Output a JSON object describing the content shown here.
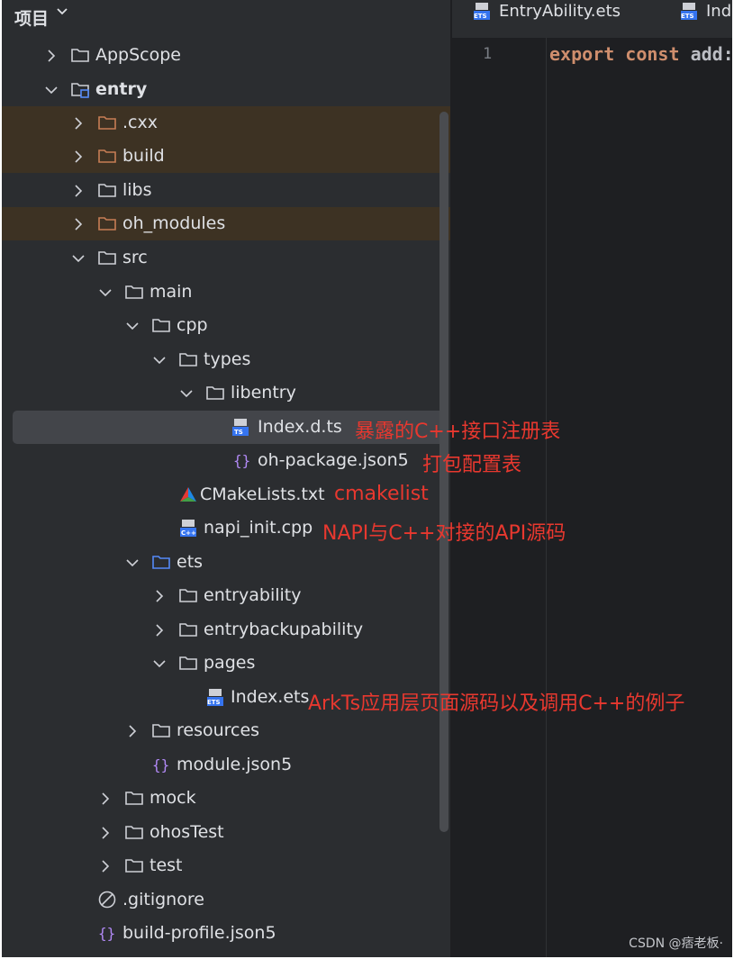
{
  "project": {
    "title": "项目"
  },
  "tabs": [
    {
      "label": "EntryAbility.ets"
    },
    {
      "label": "Ind"
    }
  ],
  "editor": {
    "line_number": "1",
    "code_keyword_export": "export",
    "code_keyword_const": "const",
    "code_rest": "add:"
  },
  "tree": [
    {
      "label": "AppScope",
      "icon": "folder-icon",
      "arrow": "chevron-right"
    },
    {
      "label": "entry",
      "icon": "module-folder-icon",
      "arrow": "chevron-down"
    },
    {
      "label": ".cxx",
      "icon": "excluded-folder-icon",
      "arrow": "chevron-right"
    },
    {
      "label": "build",
      "icon": "excluded-folder-icon",
      "arrow": "chevron-right"
    },
    {
      "label": "libs",
      "icon": "folder-icon",
      "arrow": "chevron-right"
    },
    {
      "label": "oh_modules",
      "icon": "excluded-folder-icon",
      "arrow": "chevron-right"
    },
    {
      "label": "src",
      "icon": "folder-icon",
      "arrow": "chevron-down"
    },
    {
      "label": "main",
      "icon": "folder-icon",
      "arrow": "chevron-down"
    },
    {
      "label": "cpp",
      "icon": "folder-icon",
      "arrow": "chevron-down"
    },
    {
      "label": "types",
      "icon": "folder-icon",
      "arrow": "chevron-down"
    },
    {
      "label": "libentry",
      "icon": "folder-icon",
      "arrow": "chevron-down"
    },
    {
      "label": "Index.d.ts",
      "icon": "ts-file-icon",
      "arrow": ""
    },
    {
      "label": "oh-package.json5",
      "icon": "json-braces-icon",
      "arrow": ""
    },
    {
      "label": "CMakeLists.txt",
      "icon": "cmake-icon",
      "arrow": ""
    },
    {
      "label": "napi_init.cpp",
      "icon": "cpp-file-icon",
      "arrow": ""
    },
    {
      "label": "ets",
      "icon": "source-folder-icon",
      "arrow": "chevron-down"
    },
    {
      "label": "entryability",
      "icon": "folder-icon",
      "arrow": "chevron-right"
    },
    {
      "label": "entrybackupability",
      "icon": "folder-icon",
      "arrow": "chevron-right"
    },
    {
      "label": "pages",
      "icon": "folder-icon",
      "arrow": "chevron-down"
    },
    {
      "label": "Index.ets",
      "icon": "ets-file-icon",
      "arrow": ""
    },
    {
      "label": "resources",
      "icon": "folder-icon",
      "arrow": "chevron-right"
    },
    {
      "label": "module.json5",
      "icon": "json-braces-icon",
      "arrow": ""
    },
    {
      "label": "mock",
      "icon": "folder-icon",
      "arrow": "chevron-right"
    },
    {
      "label": "ohosTest",
      "icon": "folder-icon",
      "arrow": "chevron-right"
    },
    {
      "label": "test",
      "icon": "folder-icon",
      "arrow": "chevron-right"
    },
    {
      "label": ".gitignore",
      "icon": "ignore-icon",
      "arrow": ""
    },
    {
      "label": "build-profile.json5",
      "icon": "json-braces-icon",
      "arrow": ""
    }
  ],
  "annotations": {
    "index_d_ts": "暴露的C++接口注册表",
    "oh_package": "打包配置表",
    "cmakelist": "cmakelist",
    "napi_init": "NAPI与C++对接的API源码",
    "index_ets": "ArkTs应用层页面源码以及调用C++的例子"
  },
  "watermark": "CSDN @痞老板·",
  "colors": {
    "panel_bg": "#2b2d30",
    "editor_bg": "#1e1f22",
    "excluded_row": "#3d3223",
    "selected_row": "#43454a",
    "annotation_red": "#e8382f",
    "keyword": "#cf8e6d",
    "source_folder_blue": "#548af7",
    "excluded_folder_orange": "#c77d55"
  }
}
